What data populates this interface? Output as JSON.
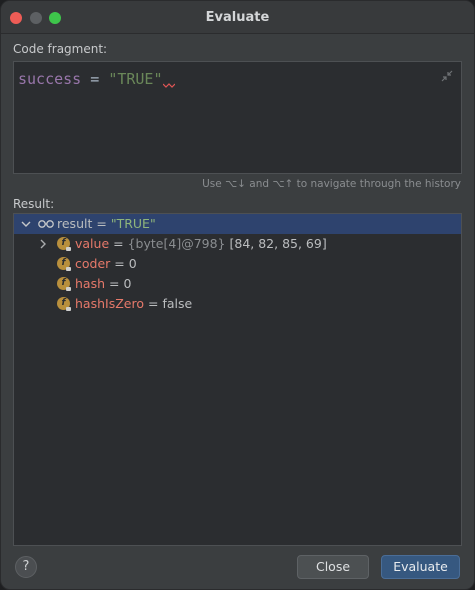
{
  "window": {
    "title": "Evaluate"
  },
  "code_fragment": {
    "label": "Code fragment:",
    "variable": "success",
    "operator": "=",
    "literal": "\"TRUE\""
  },
  "history_hint": "Use ⌥↓ and ⌥↑ to navigate through the history",
  "result": {
    "label": "Result:",
    "root": {
      "name": "result",
      "eq": "=",
      "value": "\"TRUE\""
    },
    "fields": [
      {
        "name": "value",
        "eq": "=",
        "type": "{byte[4]@798}",
        "value": "[84, 82, 85, 69]"
      },
      {
        "name": "coder",
        "eq": "=",
        "value": "0"
      },
      {
        "name": "hash",
        "eq": "=",
        "value": "0"
      },
      {
        "name": "hashIsZero",
        "eq": "=",
        "value": "false"
      }
    ]
  },
  "buttons": {
    "help": "?",
    "close": "Close",
    "evaluate": "Evaluate"
  },
  "icons": {
    "field": "field-icon",
    "watch": "glasses-icon",
    "expand": "chevron-icon"
  },
  "colors": {
    "accent": "#365880",
    "selection": "#2e436e",
    "field_name": "#e6796a",
    "string": "#8fb57b"
  }
}
